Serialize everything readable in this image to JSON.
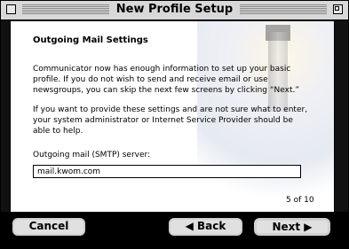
{
  "window": {
    "title": "New Profile Setup"
  },
  "content": {
    "section_title": "Outgoing Mail Settings",
    "paragraph1": "Communicator now has enough information to set up your basic profile. If you do not wish to send and receive email or use newsgroups, you can skip the next few screens by clicking “Next.”",
    "paragraph2": "If you want to provide these settings and are not sure what to enter, your system administrator or Internet Service Provider should be able to help.",
    "field_label": "Outgoing mail (SMTP) server:",
    "smtp_value": "mail.kwom.com",
    "page_count": "5 of 10"
  },
  "buttons": {
    "cancel": "Cancel",
    "back": "◀ Back",
    "next": "Next ▶"
  }
}
